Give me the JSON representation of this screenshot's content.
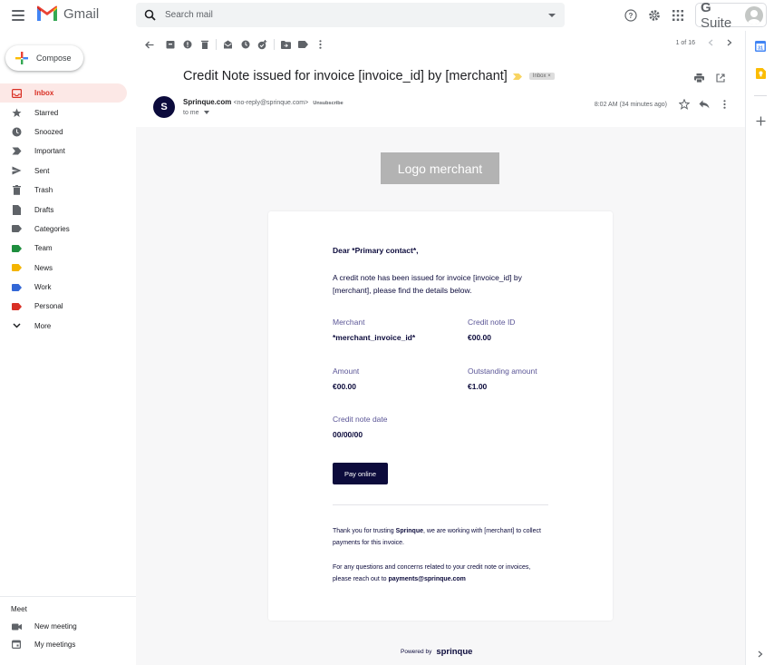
{
  "header": {
    "app_name": "Gmail",
    "search_placeholder": "Search mail",
    "suite_label_bold": "G",
    "suite_label": " Suite"
  },
  "sidebar": {
    "compose_label": "Compose",
    "items": [
      {
        "label": "Inbox",
        "icon": "inbox-icon",
        "active": true
      },
      {
        "label": "Starred",
        "icon": "star-icon"
      },
      {
        "label": "Snoozed",
        "icon": "clock-icon"
      },
      {
        "label": "Important",
        "icon": "important-icon"
      },
      {
        "label": "Sent",
        "icon": "send-icon"
      },
      {
        "label": "Trash",
        "icon": "trash-icon"
      },
      {
        "label": "Drafts",
        "icon": "draft-icon"
      },
      {
        "label": "Categories",
        "icon": "label-icon"
      },
      {
        "label": "Team",
        "icon": "label-icon",
        "color": "#1e8e3e"
      },
      {
        "label": "News",
        "icon": "label-icon",
        "color": "#f4b400"
      },
      {
        "label": "Work",
        "icon": "label-icon",
        "color": "#3367d6"
      },
      {
        "label": "Personal",
        "icon": "label-icon",
        "color": "#d93025"
      },
      {
        "label": "More",
        "icon": "chevron-down-icon"
      }
    ],
    "meet": {
      "title": "Meet",
      "items": [
        {
          "label": "New meeting",
          "icon": "video-icon"
        },
        {
          "label": "My meetings",
          "icon": "calendar-icon"
        }
      ]
    }
  },
  "toolbar": {
    "pager_text": "1 of 16"
  },
  "message": {
    "subject": "Credit Note issued for invoice [invoice_id] by [merchant]",
    "inbox_chip": "Inbox ×",
    "sender_initial": "S",
    "sender_name": "Sprinque.com",
    "sender_email": "<no-reply@sprinque.com>",
    "unsubscribe": "Unsubscribe",
    "to_me": "to me",
    "time": "8:02 AM (34 minutes ago)"
  },
  "email": {
    "logo_text": "Logo merchant",
    "greeting": "Dear *Primary contact*,",
    "intro": "A credit note has been issued for invoice [invoice_id] by [merchant], please find the details below.",
    "fields": [
      {
        "label": "Merchant",
        "value": "*merchant_invoice_id*"
      },
      {
        "label": "Credit note ID",
        "value": "€00.00"
      },
      {
        "label": "Amount",
        "value": "€00.00"
      },
      {
        "label": "Outstanding amount",
        "value": "€1.00"
      },
      {
        "label": "Credit note date",
        "value": "00/00/00"
      }
    ],
    "pay_button": "Pay online",
    "thanks_pre": "Thank you for trusting ",
    "thanks_brand": "Sprinque",
    "thanks_post": ", we are working with [merchant] to collect payments for this invoice.",
    "contact_pre": "For any questions and concerns related to your credit note or invoices, please reach out to ",
    "contact_email": "payments@sprinque.com",
    "powered_by": "Powered by",
    "brand": "sprinque"
  }
}
